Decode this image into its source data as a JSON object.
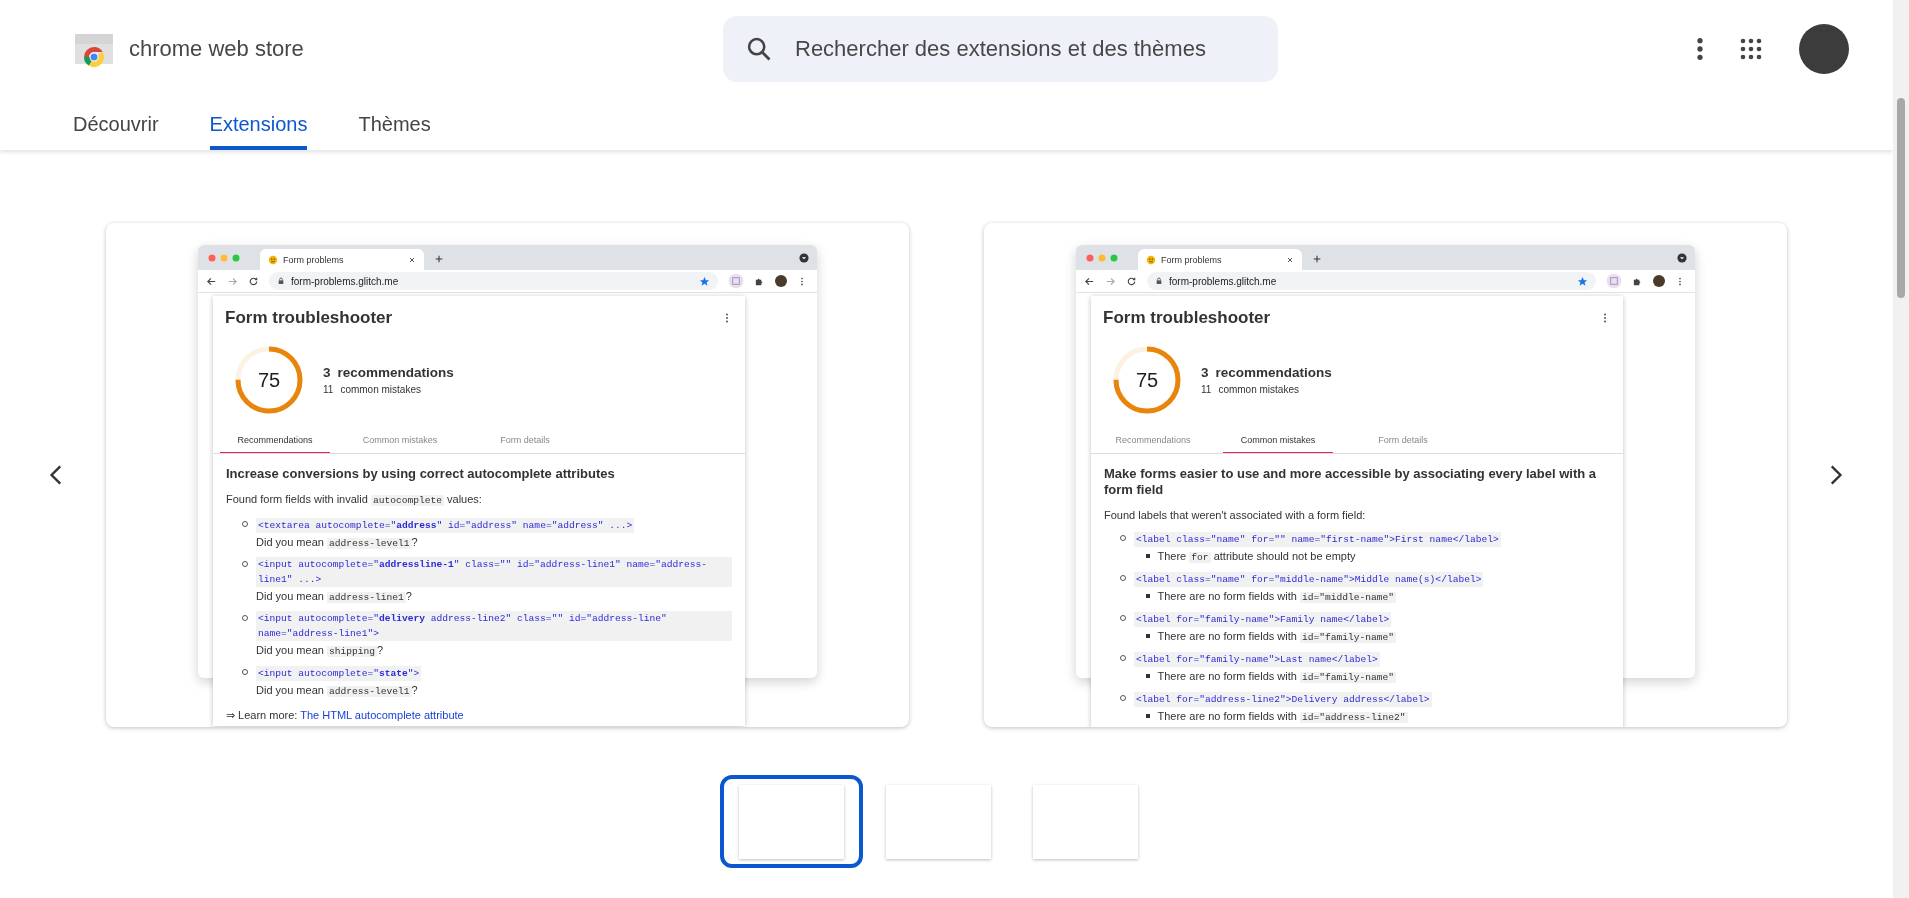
{
  "header": {
    "logo_text": "chrome web store",
    "search": {
      "placeholder": "Rechercher des extensions et des thèmes"
    },
    "tabs": [
      {
        "label": "Découvrir",
        "selected": false
      },
      {
        "label": "Extensions",
        "selected": true
      },
      {
        "label": "Thèmes",
        "selected": false
      }
    ]
  },
  "slides": [
    {
      "browser": {
        "tab_title": "Form problems",
        "url": "form-problems.glitch.me"
      },
      "panel": {
        "title": "Form troubleshooter",
        "score": "75",
        "level": 0.75,
        "summary": [
          {
            "kind": "primary",
            "count": "3",
            "label": "recommendations"
          },
          {
            "kind": "secondary",
            "count": "11",
            "label": "common mistakes"
          }
        ],
        "tabs": [
          {
            "label": "Recommendations",
            "selected": true
          },
          {
            "label": "Common mistakes",
            "selected": false
          },
          {
            "label": "Form details",
            "selected": false
          }
        ],
        "heading": "Increase conversions by using correct autocomplete attributes",
        "intro": {
          "before": "Found form fields with invalid",
          "code": "autocomplete",
          "after": "values:"
        },
        "items": [
          {
            "kind": "suggestion",
            "code": "<textarea autocomplete=\"**address**\" id=\"address\" name=\"address\" ...>",
            "detail": {
              "before": "Did you mean",
              "code": "address-level1",
              "after": "?"
            }
          },
          {
            "kind": "suggestion",
            "code": "<input autocomplete=\"**addressline-1**\" class=\"\" id=\"address-line1\" name=\"address-line1\" ...>",
            "detail": {
              "before": "Did you mean",
              "code": "address-line1",
              "after": "?"
            }
          },
          {
            "kind": "suggestion",
            "code": "<input autocomplete=\"**delivery** address-line2\" class=\"\" id=\"address-line\" name=\"address-line1\">",
            "detail": {
              "before": "Did you mean",
              "code": "shipping",
              "after": "?"
            }
          },
          {
            "kind": "suggestion",
            "code": "<input autocomplete=\"**state**\">",
            "detail": {
              "before": "Did you mean",
              "code": "address-level1",
              "after": "?"
            }
          }
        ],
        "footer": {
          "text": "⇒ Learn more:",
          "link": "The HTML autocomplete attribute"
        }
      }
    },
    {
      "browser": {
        "tab_title": "Form problems",
        "url": "form-problems.glitch.me"
      },
      "panel": {
        "title": "Form troubleshooter",
        "score": "75",
        "level": 0.75,
        "summary": [
          {
            "kind": "primary",
            "count": "3",
            "label": "recommendations"
          },
          {
            "kind": "secondary",
            "count": "11",
            "label": "common mistakes"
          }
        ],
        "tabs": [
          {
            "label": "Recommendations",
            "selected": false
          },
          {
            "label": "Common mistakes",
            "selected": true
          },
          {
            "label": "Form details",
            "selected": false
          }
        ],
        "heading": "Make forms easier to use and more accessible by associating every label with a form field",
        "intro": {
          "before": "Found labels that weren't associated with a form field:"
        },
        "items": [
          {
            "kind": "issue",
            "code": "<label class=\"name\" for=\"\" name=\"first-name\">First name</label>",
            "detail": {
              "before": "There",
              "code": "for",
              "after": "attribute should not be empty"
            }
          },
          {
            "kind": "issue",
            "code": "<label class=\"name\" for=\"middle-name\">Middle name(s)</label>",
            "detail": {
              "before": "There are no form fields with",
              "code": "id=\"middle-name\""
            }
          },
          {
            "kind": "issue",
            "code": "<label for=\"family-name\">Family name</label>",
            "detail": {
              "before": "There are no form fields with",
              "code": "id=\"family-name\""
            }
          },
          {
            "kind": "issue",
            "code": "<label for=\"family-name\">Last name</label>",
            "detail": {
              "before": "There are no form fields with",
              "code": "id=\"family-name\""
            }
          },
          {
            "kind": "issue",
            "code": "<label for=\"address-line2\">Delivery address</label>",
            "detail": {
              "before": "There are no form fields with",
              "code": "id=\"address-line2\""
            }
          }
        ]
      }
    }
  ],
  "thumbnails": [
    {
      "selected": true
    },
    {
      "selected": false
    },
    {
      "selected": false
    }
  ]
}
